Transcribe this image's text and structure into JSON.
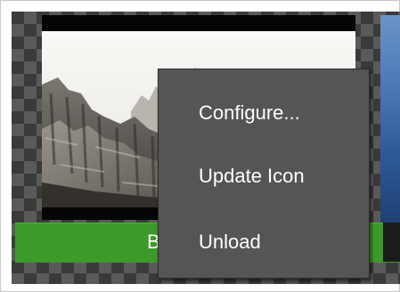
{
  "title_band": {
    "text": "B",
    "color": "#3c9a2a"
  },
  "thumbnail": {
    "description_icon": "mountain-landscape-image"
  },
  "context_menu": {
    "items": [
      {
        "label": "Configure..."
      },
      {
        "label": "Update Icon"
      },
      {
        "label": "Unload"
      }
    ]
  },
  "colors": {
    "menu_background": "#555555",
    "menu_text": "#ffffff",
    "checker_light": "#5a5a5a",
    "checker_dark": "#3a3a3a"
  }
}
